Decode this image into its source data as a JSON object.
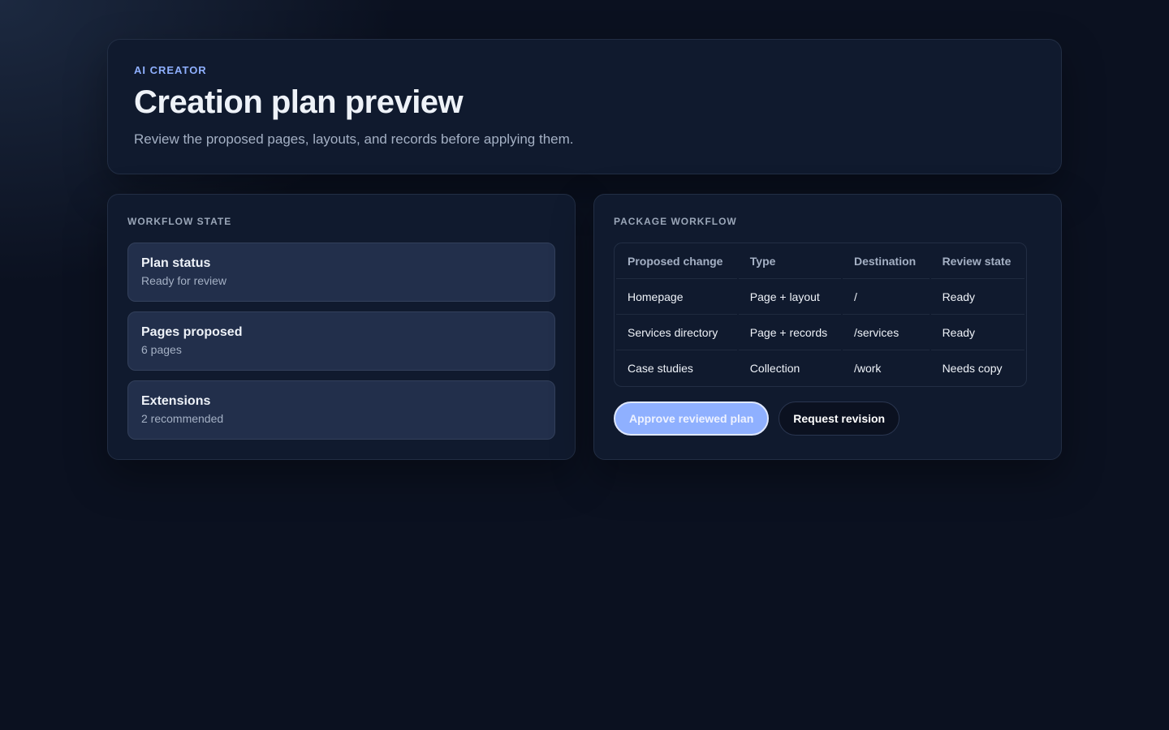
{
  "hero": {
    "eyebrow": "AI CREATOR",
    "title": "Creation plan preview",
    "subtitle": "Review the proposed pages, layouts, and records before applying them."
  },
  "workflow_state": {
    "title": "WORKFLOW STATE",
    "items": [
      {
        "label": "Plan status",
        "value": "Ready for review"
      },
      {
        "label": "Pages proposed",
        "value": "6 pages"
      },
      {
        "label": "Extensions",
        "value": "2 recommended"
      }
    ]
  },
  "package_workflow": {
    "title": "PACKAGE WORKFLOW",
    "columns": [
      "Proposed change",
      "Type",
      "Destination",
      "Review state"
    ],
    "rows": [
      [
        "Homepage",
        "Page + layout",
        "/",
        "Ready"
      ],
      [
        "Services directory",
        "Page + records",
        "/services",
        "Ready"
      ],
      [
        "Case studies",
        "Collection",
        "/work",
        "Needs copy"
      ]
    ],
    "approve_label": "Approve reviewed plan",
    "revision_label": "Request revision"
  }
}
